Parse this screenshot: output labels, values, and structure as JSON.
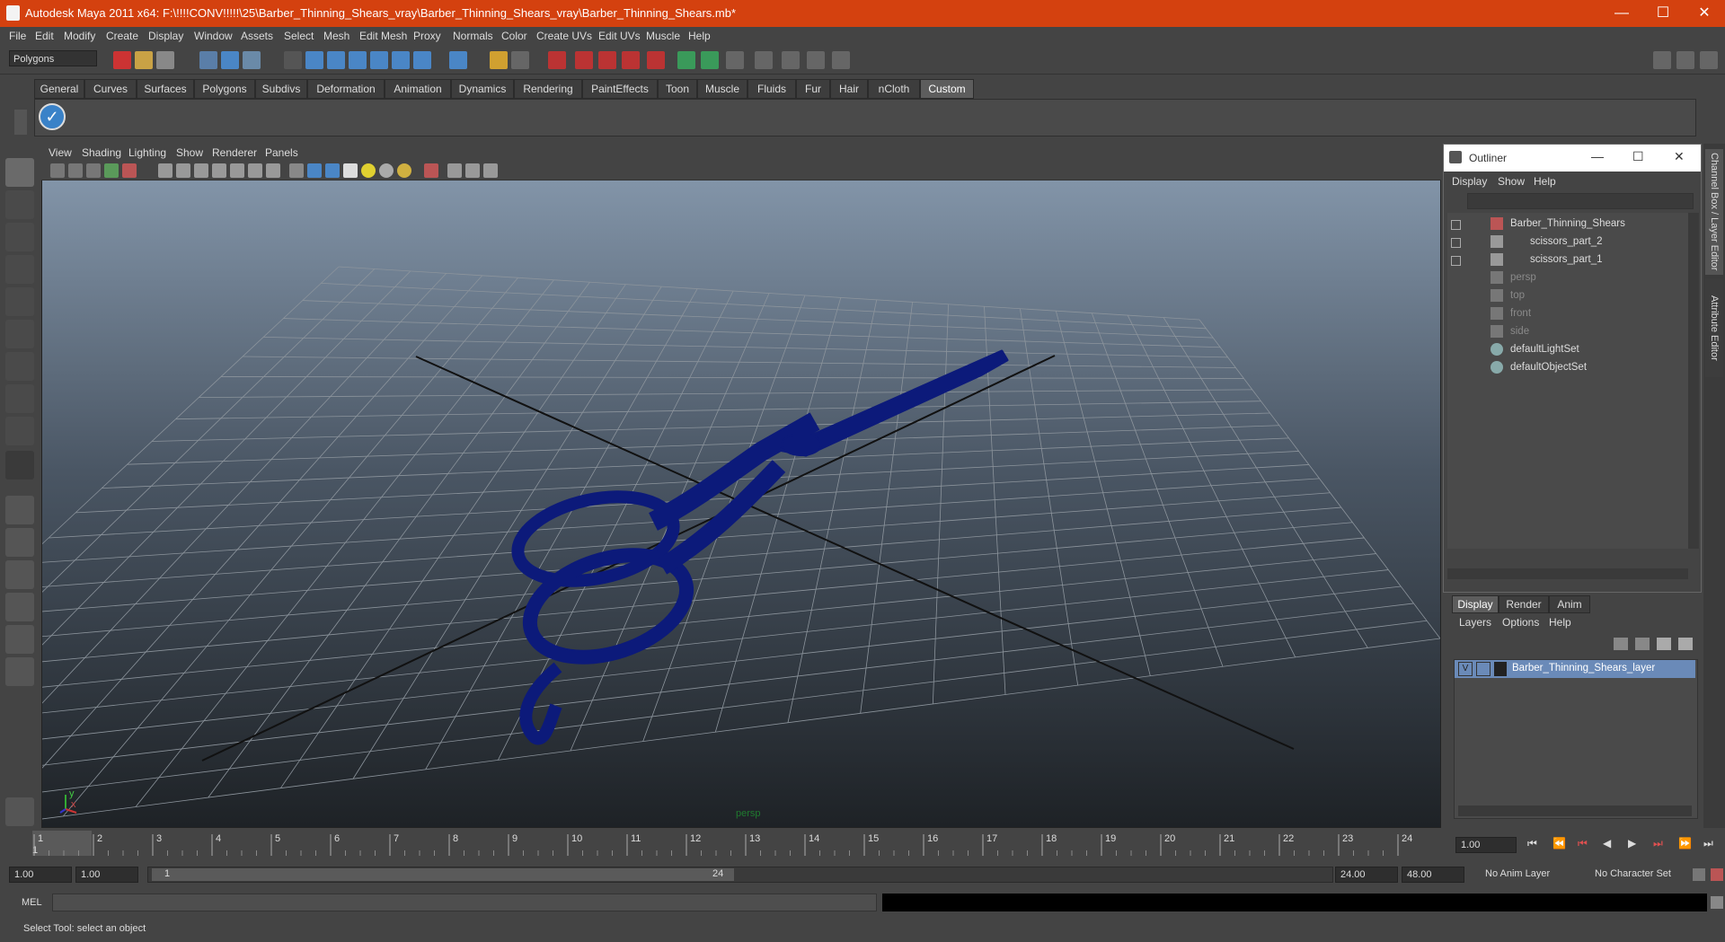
{
  "window": {
    "title": "Autodesk Maya 2011 x64: F:\\!!!!CONV!!!!!\\25\\Barber_Thinning_Shears_vray\\Barber_Thinning_Shears_vray\\Barber_Thinning_Shears.mb*",
    "minimize": "—",
    "maximize": "☐",
    "close": "✕"
  },
  "menubar": [
    "File",
    "Edit",
    "Modify",
    "Create",
    "Display",
    "Window",
    "Assets",
    "Select",
    "Mesh",
    "Edit Mesh",
    "Proxy",
    "Normals",
    "Color",
    "Create UVs",
    "Edit UVs",
    "Muscle",
    "Help"
  ],
  "status_line": {
    "mode": "Polygons"
  },
  "shelf": {
    "tabs": [
      "General",
      "Curves",
      "Surfaces",
      "Polygons",
      "Subdivs",
      "Deformation",
      "Animation",
      "Dynamics",
      "Rendering",
      "PaintEffects",
      "Toon",
      "Muscle",
      "Fluids",
      "Fur",
      "Hair",
      "nCloth",
      "Custom"
    ],
    "active": "Custom"
  },
  "viewport": {
    "menu": [
      "View",
      "Shading",
      "Lighting",
      "Show",
      "Renderer",
      "Panels"
    ],
    "camera_label": "persp",
    "axis_labels": {
      "y": "y",
      "x": "x"
    },
    "grid_color": "#8c949c",
    "mesh_color": "#0c1a7a"
  },
  "outliner": {
    "title": "Outliner",
    "menu": [
      "Display",
      "Show",
      "Help"
    ],
    "items": [
      {
        "label": "Barber_Thinning_Shears",
        "dim": false
      },
      {
        "label": "scissors_part_2",
        "dim": false
      },
      {
        "label": "scissors_part_1",
        "dim": false
      },
      {
        "label": "persp",
        "dim": true
      },
      {
        "label": "top",
        "dim": true
      },
      {
        "label": "front",
        "dim": true
      },
      {
        "label": "side",
        "dim": true
      },
      {
        "label": "defaultLightSet",
        "dim": false
      },
      {
        "label": "defaultObjectSet",
        "dim": false
      }
    ]
  },
  "layer_editor": {
    "tabs": [
      "Display",
      "Render",
      "Anim"
    ],
    "active_tab": "Display",
    "menu": [
      "Layers",
      "Options",
      "Help"
    ],
    "layer": {
      "visible": "V",
      "name": "Barber_Thinning_Shears_layer"
    }
  },
  "side_tabs": [
    "Channel Box / Layer Editor",
    "Attribute Editor"
  ],
  "timeline": {
    "ticks": [
      "1",
      "2",
      "3",
      "4",
      "5",
      "6",
      "7",
      "8",
      "9",
      "10",
      "11",
      "12",
      "13",
      "14",
      "15",
      "16",
      "17",
      "18",
      "19",
      "20",
      "21",
      "22",
      "23",
      "24"
    ],
    "current_frame_field": "1.00",
    "current_marker": "1"
  },
  "range": {
    "start": "1.00",
    "playback_start": "1.00",
    "slider_start": "1",
    "slider_end": "24",
    "playback_end": "24.00",
    "end": "48.00",
    "anim_layer": "No Anim Layer",
    "char_set": "No Character Set"
  },
  "command": {
    "label": "MEL"
  },
  "help_line": "Select Tool: select an object"
}
